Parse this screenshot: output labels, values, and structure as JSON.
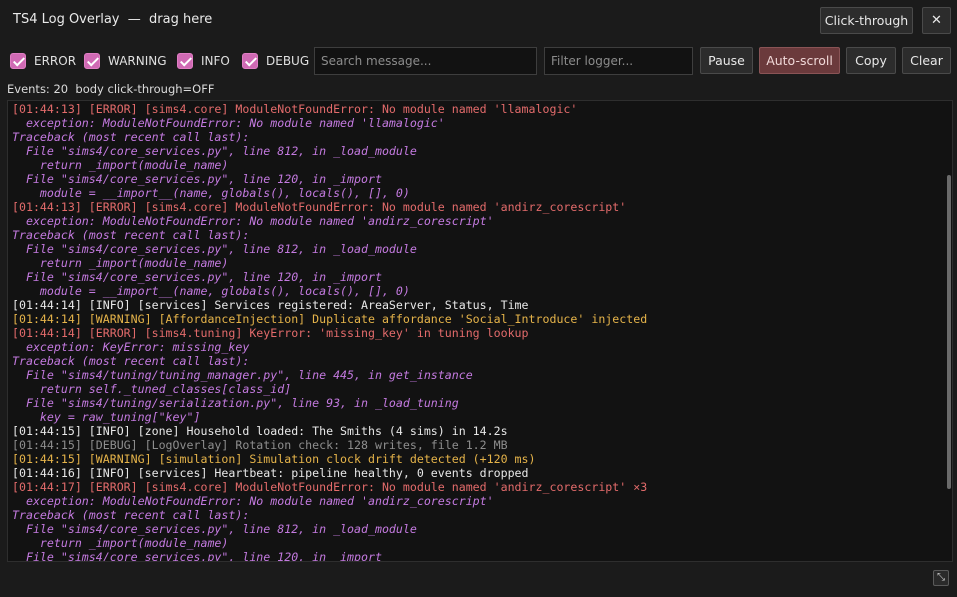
{
  "window": {
    "title": "TS4 Log Overlay  —  drag here"
  },
  "titlebar": {
    "clickthrough_label": "Click-through",
    "close_glyph": "✕"
  },
  "filters": {
    "levels": [
      {
        "label": "ERROR",
        "checked": true
      },
      {
        "label": "WARNING",
        "checked": true
      },
      {
        "label": "INFO",
        "checked": true
      },
      {
        "label": "DEBUG",
        "checked": true
      }
    ],
    "search_placeholder": "Search message...",
    "logger_placeholder": "Filter logger..."
  },
  "toolbar": {
    "pause_label": "Pause",
    "autoscroll_label": "Auto-scroll",
    "copy_label": "Copy",
    "clear_label": "Clear"
  },
  "status": {
    "text": "Events: 20  body click-through=OFF"
  },
  "colors": {
    "error": "#e36b6b",
    "detail": "#c47ae0",
    "info": "#e8e8e8",
    "warning": "#e6b44a",
    "debug": "#8e8e8e",
    "checkbox": "#d06ab4",
    "autoscroll_active": "#6b3a3c"
  },
  "log": {
    "lines": [
      {
        "kind": "error",
        "text": "[01:44:13] [ERROR] [sims4.core] ModuleNotFoundError: No module named 'llamalogic'"
      },
      {
        "kind": "detail",
        "text": "  exception: ModuleNotFoundError: No module named 'llamalogic'"
      },
      {
        "kind": "detail",
        "text": "Traceback (most recent call last):"
      },
      {
        "kind": "detail",
        "text": "  File \"sims4/core_services.py\", line 812, in _load_module"
      },
      {
        "kind": "detail",
        "text": "    return _import(module_name)"
      },
      {
        "kind": "detail",
        "text": "  File \"sims4/core_services.py\", line 120, in _import"
      },
      {
        "kind": "detail",
        "text": "    module = __import__(name, globals(), locals(), [], 0)"
      },
      {
        "kind": "error",
        "text": "[01:44:13] [ERROR] [sims4.core] ModuleNotFoundError: No module named 'andirz_corescript'"
      },
      {
        "kind": "detail",
        "text": "  exception: ModuleNotFoundError: No module named 'andirz_corescript'"
      },
      {
        "kind": "detail",
        "text": "Traceback (most recent call last):"
      },
      {
        "kind": "detail",
        "text": "  File \"sims4/core_services.py\", line 812, in _load_module"
      },
      {
        "kind": "detail",
        "text": "    return _import(module_name)"
      },
      {
        "kind": "detail",
        "text": "  File \"sims4/core_services.py\", line 120, in _import"
      },
      {
        "kind": "detail",
        "text": "    module = __import__(name, globals(), locals(), [], 0)"
      },
      {
        "kind": "info",
        "text": "[01:44:14] [INFO] [services] Services registered: AreaServer, Status, Time"
      },
      {
        "kind": "warning",
        "text": "[01:44:14] [WARNING] [AffordanceInjection] Duplicate affordance 'Social_Introduce' injected"
      },
      {
        "kind": "error",
        "text": "[01:44:14] [ERROR] [sims4.tuning] KeyError: 'missing_key' in tuning lookup"
      },
      {
        "kind": "detail",
        "text": "  exception: KeyError: missing_key"
      },
      {
        "kind": "detail",
        "text": "Traceback (most recent call last):"
      },
      {
        "kind": "detail",
        "text": "  File \"sims4/tuning/tuning_manager.py\", line 445, in get_instance"
      },
      {
        "kind": "detail",
        "text": "    return self._tuned_classes[class_id]"
      },
      {
        "kind": "detail",
        "text": "  File \"sims4/tuning/serialization.py\", line 93, in _load_tuning"
      },
      {
        "kind": "detail",
        "text": "    key = raw_tuning[\"key\"]"
      },
      {
        "kind": "info",
        "text": "[01:44:15] [INFO] [zone] Household loaded: The Smiths (4 sims) in 14.2s"
      },
      {
        "kind": "debug",
        "text": "[01:44:15] [DEBUG] [LogOverlay] Rotation check: 128 writes, file 1.2 MB"
      },
      {
        "kind": "warning",
        "text": "[01:44:15] [WARNING] [simulation] Simulation clock drift detected (+120 ms)"
      },
      {
        "kind": "info",
        "text": "[01:44:16] [INFO] [services] Heartbeat: pipeline healthy, 0 events dropped"
      },
      {
        "kind": "error",
        "text": "[01:44:17] [ERROR] [sims4.core] ModuleNotFoundError: No module named 'andirz_corescript' ×3"
      },
      {
        "kind": "detail",
        "text": "  exception: ModuleNotFoundError: No module named 'andirz_corescript'"
      },
      {
        "kind": "detail",
        "text": "Traceback (most recent call last):"
      },
      {
        "kind": "detail",
        "text": "  File \"sims4/core_services.py\", line 812, in _load_module"
      },
      {
        "kind": "detail",
        "text": "    return _import(module_name)"
      },
      {
        "kind": "detail",
        "text": "  File \"sims4/core_services.py\", line 120, in _import"
      }
    ]
  },
  "footer": {
    "resize_glyph": "⤡"
  }
}
